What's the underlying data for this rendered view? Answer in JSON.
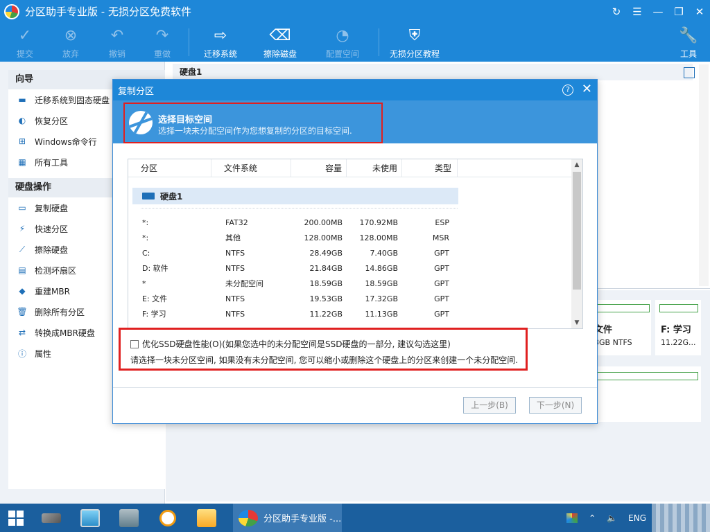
{
  "window": {
    "title": "分区助手专业版 - 无损分区免费软件",
    "controls": [
      "↻",
      "☰",
      "—",
      "❐",
      "✕"
    ]
  },
  "toolbar": {
    "commit": "提交",
    "discard": "放弃",
    "undo": "撤销",
    "redo": "重做",
    "migrate": "迁移系统",
    "wipe": "擦除磁盘",
    "config": "配置空间",
    "tutorial": "无损分区教程",
    "tools": "工具"
  },
  "sidebar": {
    "wizard_title": "向导",
    "wizard_items": [
      "迁移系统到固态硬盘",
      "恢复分区",
      "Windows命令行",
      "所有工具"
    ],
    "disk_ops_title": "硬盘操作",
    "disk_ops_items": [
      "复制硬盘",
      "快速分区",
      "擦除硬盘",
      "检测坏扇区",
      "重建MBR",
      "删除所有分区",
      "转换成MBR硬盘",
      "属性"
    ]
  },
  "main": {
    "disk_label": "硬盘1",
    "card_e_name": "文件",
    "card_e_size": "3GB NTFS",
    "card_f_name": "F: 学习",
    "card_f_size": "11.22G..."
  },
  "dialog": {
    "title": "复制分区",
    "help": "?",
    "banner_title": "选择目标空间",
    "banner_sub": "选择一块未分配空间作为您想复制的分区的目标空间.",
    "columns": [
      "分区",
      "文件系统",
      "容量",
      "未使用",
      "类型"
    ],
    "disk_name": "硬盘1",
    "rows": [
      {
        "part": "*:",
        "fs": "FAT32",
        "cap": "200.00MB",
        "unused": "170.92MB",
        "type": "ESP"
      },
      {
        "part": "*:",
        "fs": "其他",
        "cap": "128.00MB",
        "unused": "128.00MB",
        "type": "MSR"
      },
      {
        "part": "C:",
        "fs": "NTFS",
        "cap": "28.49GB",
        "unused": "7.40GB",
        "type": "GPT"
      },
      {
        "part": "D: 软件",
        "fs": "NTFS",
        "cap": "21.84GB",
        "unused": "14.86GB",
        "type": "GPT"
      },
      {
        "part": "*",
        "fs": "未分配空间",
        "cap": "18.59GB",
        "unused": "18.59GB",
        "type": "GPT"
      },
      {
        "part": "E: 文件",
        "fs": "NTFS",
        "cap": "19.53GB",
        "unused": "17.32GB",
        "type": "GPT"
      },
      {
        "part": "F: 学习",
        "fs": "NTFS",
        "cap": "11.22GB",
        "unused": "11.13GB",
        "type": "GPT"
      }
    ],
    "ssd_checkbox": "优化SSD硬盘性能(O)(如果您选中的未分配空间是SSD硬盘的一部分, 建议勾选这里)",
    "hint": "请选择一块未分区空间, 如果没有未分配空间, 您可以缩小或删除这个硬盘上的分区来创建一个未分配空间.",
    "back_button": "上一步(B)",
    "next_button": "下一步(N)"
  },
  "taskbar": {
    "active_app": "分区助手专业版 -...",
    "lang": "ENG"
  }
}
